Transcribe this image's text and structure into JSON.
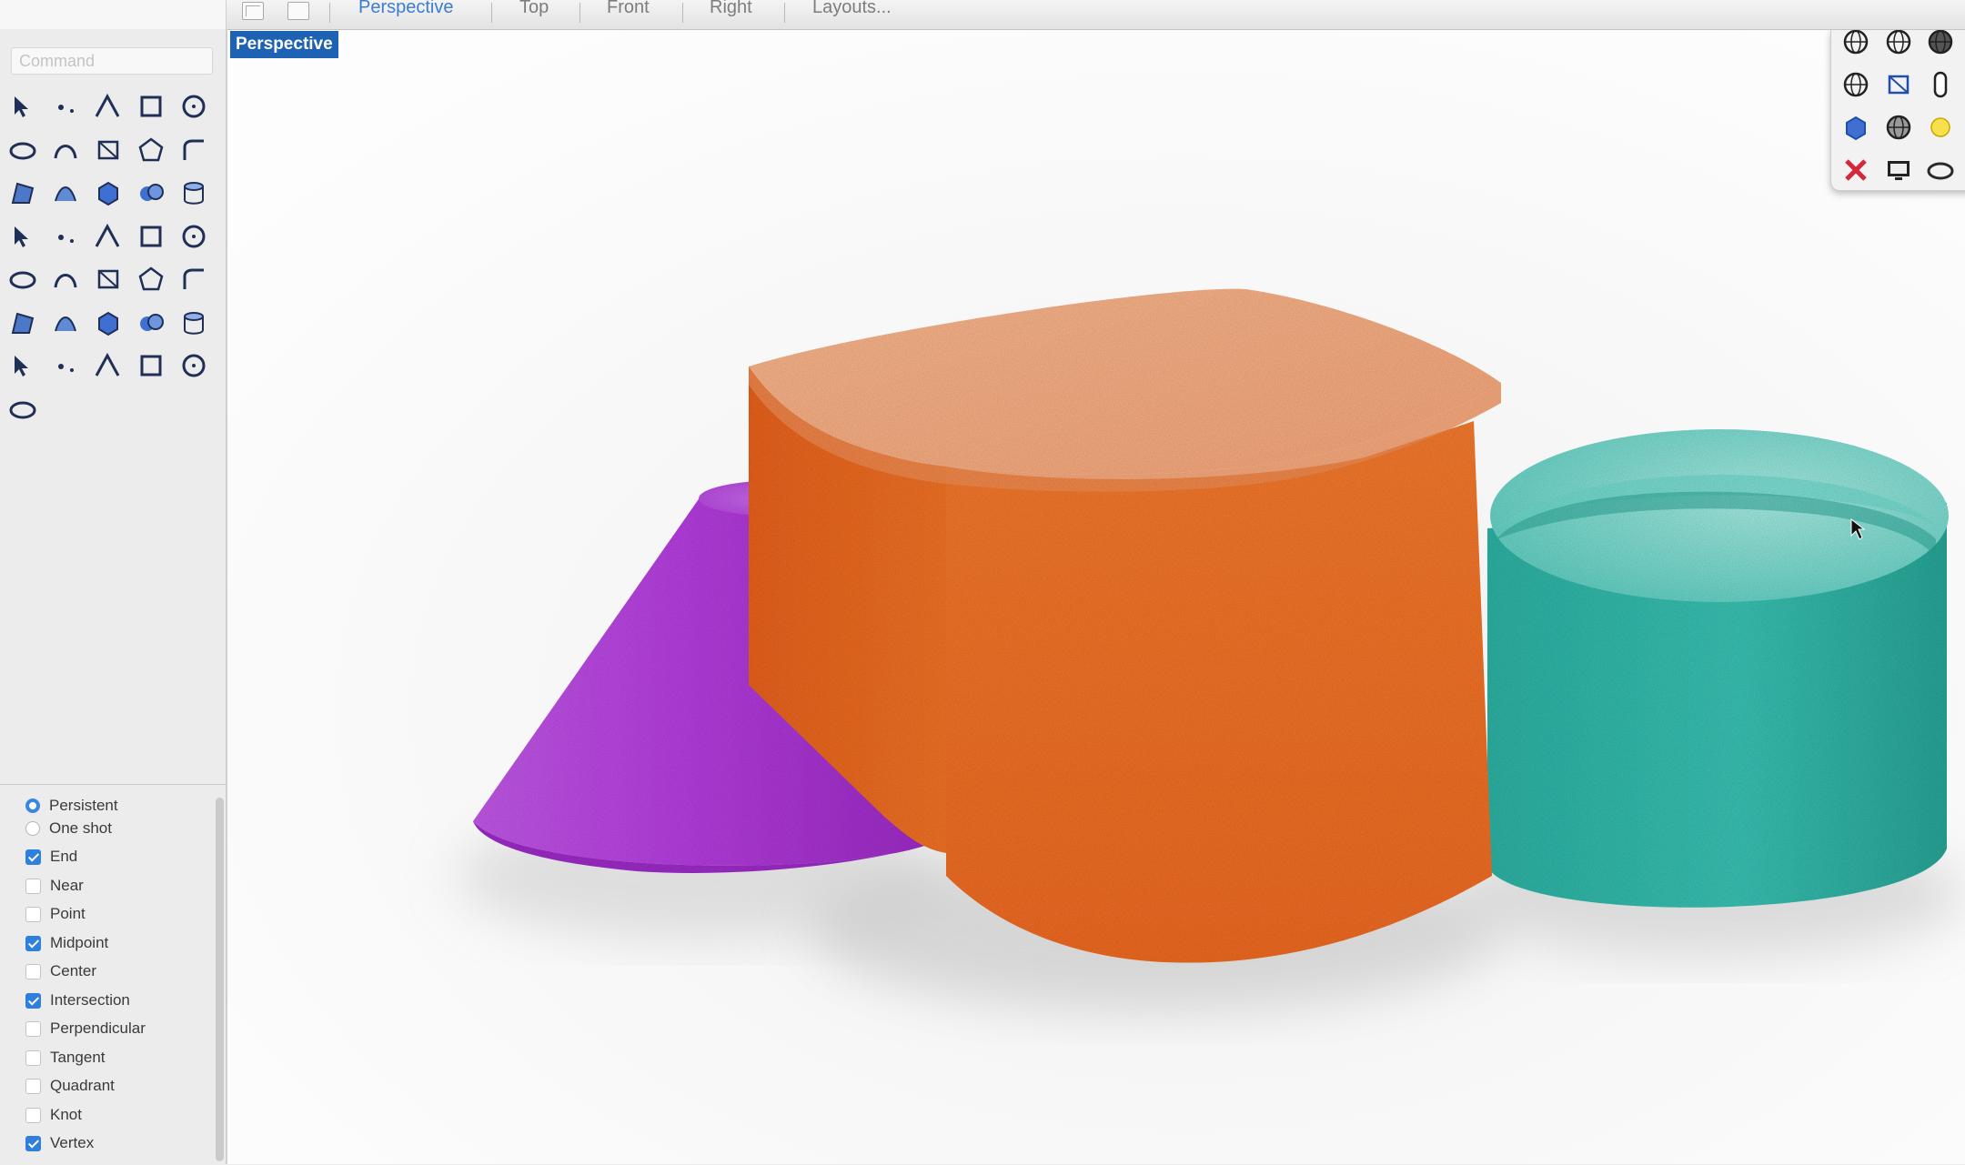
{
  "tabs": [
    {
      "label": "Perspective",
      "active": true
    },
    {
      "label": "Top",
      "active": false
    },
    {
      "label": "Front",
      "active": false
    },
    {
      "label": "Right",
      "active": false
    },
    {
      "label": "Layouts...",
      "active": false
    }
  ],
  "command": {
    "placeholder": "Command",
    "value": ""
  },
  "viewport": {
    "label": "Perspective"
  },
  "tools": [
    "select-arrow-icon",
    "point-icon",
    "polyline-icon",
    "curve-control-points-icon",
    "circle-icon",
    "ellipse-icon",
    "arc-icon",
    "rectangle-icon",
    "polygon-icon",
    "fillet-curves-icon",
    "surface-from-points-icon",
    "surface-from-curves-icon",
    "box-solid-icon",
    "boolean-union-icon",
    "cylinder-solid-icon",
    "plane-surface-icon",
    "extrude-icon",
    "explode-icon",
    "join-icon",
    "trim-icon",
    "analyze-icon",
    "group-icon",
    "offset-icon",
    "rotate-icon",
    "text-icon",
    "dimension-icon",
    "array-icon",
    "mirror-icon",
    "render-box-icon",
    "measure-icon",
    "grid-array-icon",
    "layer-icon",
    "document-properties-icon",
    "check-icon",
    "zoom-icon",
    "hatch-icon"
  ],
  "palette_tools": [
    "sphere-wire-icon",
    "sphere-wire-2-icon",
    "sphere-shaded-icon",
    "sphere-blue-icon",
    "sphere-orange-icon",
    "globe-icon",
    "torus-icon",
    "mesh-icon",
    "capsule-icon",
    "capsule-2-icon",
    "capsule-gold-icon",
    "material-blue-icon",
    "material-mix-icon",
    "sphere-gray-icon",
    "light-bulb-icon",
    "target-icon",
    "camera-icon",
    "sun-icon",
    "render-x-icon",
    "monitor-icon",
    "texture-icon",
    "environment-icon",
    "color-palette-icon"
  ],
  "snaps": [
    {
      "label": "Persistent",
      "kind": "radio",
      "checked": true
    },
    {
      "label": "One shot",
      "kind": "radio",
      "checked": false
    },
    {
      "label": "End",
      "kind": "check",
      "checked": true
    },
    {
      "label": "Near",
      "kind": "check",
      "checked": false
    },
    {
      "label": "Point",
      "kind": "check",
      "checked": false
    },
    {
      "label": "Midpoint",
      "kind": "check",
      "checked": true
    },
    {
      "label": "Center",
      "kind": "check",
      "checked": false
    },
    {
      "label": "Intersection",
      "kind": "check",
      "checked": true
    },
    {
      "label": "Perpendicular",
      "kind": "check",
      "checked": false
    },
    {
      "label": "Tangent",
      "kind": "check",
      "checked": false
    },
    {
      "label": "Quadrant",
      "kind": "check",
      "checked": false
    },
    {
      "label": "Knot",
      "kind": "check",
      "checked": false
    },
    {
      "label": "Vertex",
      "kind": "check",
      "checked": true
    }
  ],
  "scene": {
    "objects": [
      {
        "name": "cone",
        "color": "#b93ee0"
      },
      {
        "name": "box",
        "color": "#f0722a"
      },
      {
        "name": "cylinder",
        "color": "#2fb6a8"
      }
    ]
  }
}
